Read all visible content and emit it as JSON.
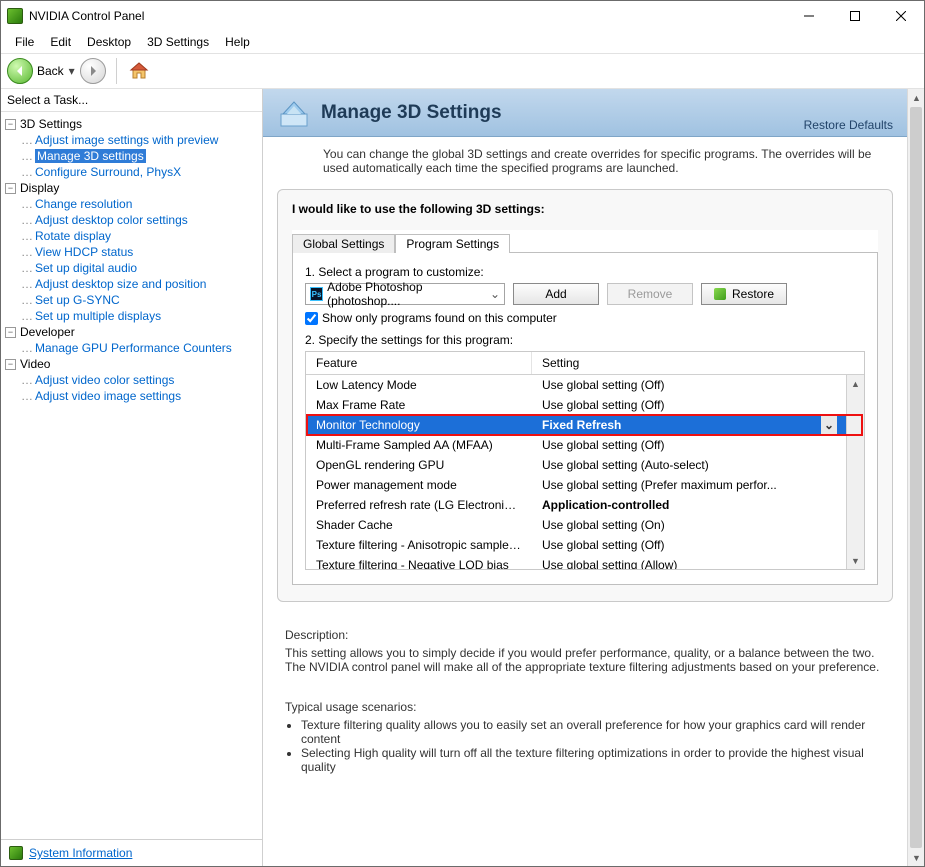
{
  "window": {
    "title": "NVIDIA Control Panel"
  },
  "menu": [
    "File",
    "Edit",
    "Desktop",
    "3D Settings",
    "Help"
  ],
  "toolbar": {
    "back_label": "Back"
  },
  "sidebar": {
    "header": "Select a Task...",
    "groups": [
      {
        "label": "3D Settings",
        "items": [
          "Adjust image settings with preview",
          "Manage 3D settings",
          "Configure Surround, PhysX"
        ],
        "selected": 1
      },
      {
        "label": "Display",
        "items": [
          "Change resolution",
          "Adjust desktop color settings",
          "Rotate display",
          "View HDCP status",
          "Set up digital audio",
          "Adjust desktop size and position",
          "Set up G-SYNC",
          "Set up multiple displays"
        ]
      },
      {
        "label": "Developer",
        "items": [
          "Manage GPU Performance Counters"
        ]
      },
      {
        "label": "Video",
        "items": [
          "Adjust video color settings",
          "Adjust video image settings"
        ]
      }
    ],
    "sysinfo": "System Information"
  },
  "header": {
    "title": "Manage 3D Settings",
    "restore": "Restore Defaults"
  },
  "intro": "You can change the global 3D settings and create overrides for specific programs. The overrides will be used automatically each time the specified programs are launched.",
  "panel": {
    "lead": "I would like to use the following 3D settings:",
    "tabs": [
      "Global Settings",
      "Program Settings"
    ],
    "active_tab": 1,
    "step1": "1. Select a program to customize:",
    "program": "Adobe Photoshop (photoshop....",
    "buttons": {
      "add": "Add",
      "remove": "Remove",
      "restore": "Restore"
    },
    "show_only": "Show only programs found on this computer",
    "step2": "2. Specify the settings for this program:",
    "head": {
      "feature": "Feature",
      "setting": "Setting"
    },
    "rows": [
      {
        "f": "Low Latency Mode",
        "s": "Use global setting (Off)"
      },
      {
        "f": "Max Frame Rate",
        "s": "Use global setting (Off)"
      },
      {
        "f": "Monitor Technology",
        "s": "Fixed Refresh",
        "selected": true
      },
      {
        "f": "Multi-Frame Sampled AA (MFAA)",
        "s": "Use global setting (Off)"
      },
      {
        "f": "OpenGL rendering GPU",
        "s": "Use global setting (Auto-select)"
      },
      {
        "f": "Power management mode",
        "s": "Use global setting (Prefer maximum perfor..."
      },
      {
        "f": "Preferred refresh rate (LG Electronics LG ...",
        "s": "Application-controlled",
        "bold": true
      },
      {
        "f": "Shader Cache",
        "s": "Use global setting (On)"
      },
      {
        "f": "Texture filtering - Anisotropic sample opti...",
        "s": "Use global setting (Off)"
      },
      {
        "f": "Texture filtering - Negative LOD bias",
        "s": "Use global setting (Allow)"
      }
    ]
  },
  "description": {
    "label": "Description:",
    "text": "This setting allows you to simply decide if you would prefer performance, quality, or a balance between the two. The NVIDIA control panel will make all of the appropriate texture filtering adjustments based on your preference."
  },
  "scenarios": {
    "label": "Typical usage scenarios:",
    "items": [
      "Texture filtering quality allows you to easily set an overall preference for how your graphics card will render content",
      "Selecting High quality will turn off all the texture filtering optimizations in order to provide the highest visual quality"
    ]
  }
}
